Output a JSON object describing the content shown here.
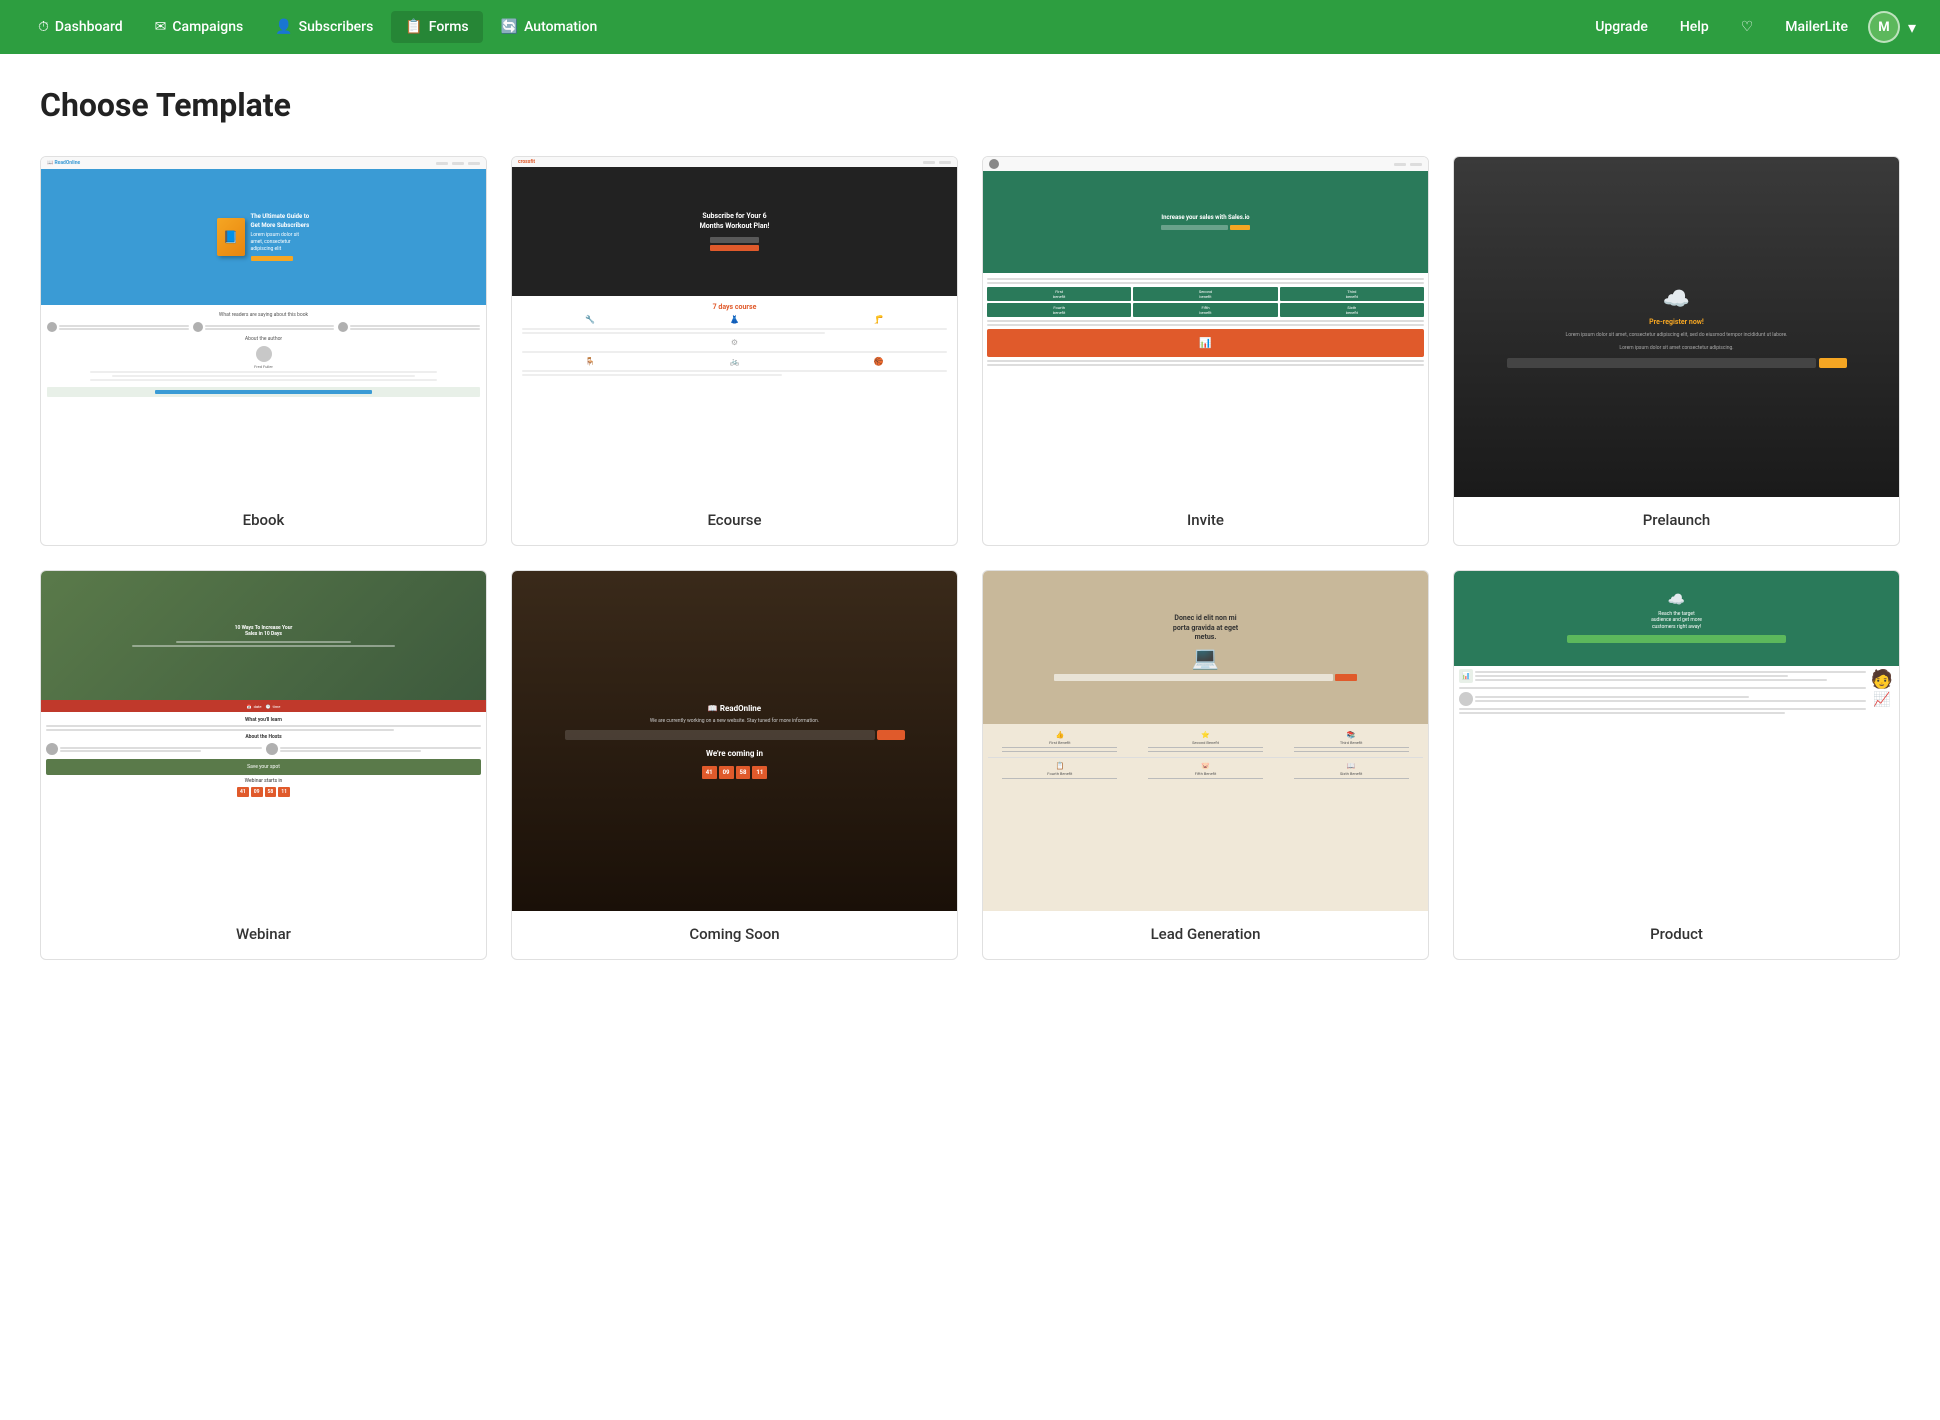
{
  "navbar": {
    "brand": "MailerLite",
    "items": [
      {
        "label": "Dashboard",
        "icon": "⏱",
        "active": false
      },
      {
        "label": "Campaigns",
        "icon": "✉",
        "active": false
      },
      {
        "label": "Subscribers",
        "icon": "👤",
        "active": false
      },
      {
        "label": "Forms",
        "icon": "📋",
        "active": true
      },
      {
        "label": "Automation",
        "icon": "🔄",
        "active": false
      }
    ],
    "right_items": [
      {
        "label": "Upgrade",
        "icon": ""
      },
      {
        "label": "Help",
        "icon": ""
      },
      {
        "label": "♡",
        "icon": ""
      }
    ],
    "user_initials": "M"
  },
  "page": {
    "title": "Choose Template"
  },
  "templates": [
    {
      "id": "ebook",
      "label": "Ebook",
      "type": "ebook"
    },
    {
      "id": "ecourse",
      "label": "Ecourse",
      "type": "ecourse"
    },
    {
      "id": "invite",
      "label": "Invite",
      "type": "invite"
    },
    {
      "id": "prelaunch",
      "label": "Prelaunch",
      "type": "prelaunch"
    },
    {
      "id": "webinar",
      "label": "Webinar",
      "type": "webinar"
    },
    {
      "id": "coming-soon",
      "label": "Coming Soon",
      "type": "coming-soon"
    },
    {
      "id": "lead-generation",
      "label": "Lead Generation",
      "type": "lead-generation"
    },
    {
      "id": "product",
      "label": "Product",
      "type": "product"
    }
  ]
}
